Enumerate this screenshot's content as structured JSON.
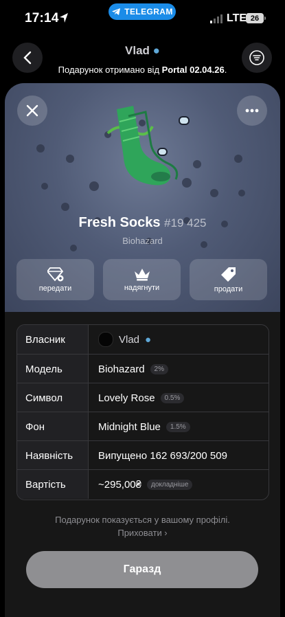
{
  "status_bar": {
    "time": "17:14",
    "telegram_label": "TELEGRAM",
    "network": "LTE",
    "battery": "26"
  },
  "header": {
    "name": "Vlad",
    "subtitle_prefix": "Подарунок отримано від ",
    "subtitle_bold": "Portal 02.04.26",
    "subtitle_suffix": "."
  },
  "gift": {
    "name": "Fresh Socks",
    "number": "#19 425",
    "model": "Biohazard"
  },
  "actions": [
    {
      "label": "передати",
      "icon": "gem-transfer-icon"
    },
    {
      "label": "надягнути",
      "icon": "crown-icon"
    },
    {
      "label": "продати",
      "icon": "price-tag-icon"
    }
  ],
  "details": [
    {
      "label": "Власник",
      "value": "Vlad",
      "badge": ""
    },
    {
      "label": "Модель",
      "value": "Biohazard",
      "badge": "2%"
    },
    {
      "label": "Символ",
      "value": "Lovely Rose",
      "badge": "0.5%"
    },
    {
      "label": "Фон",
      "value": "Midnight Blue",
      "badge": "1.5%"
    },
    {
      "label": "Наявність",
      "value": "Випущено 162 693/200 509",
      "badge": ""
    },
    {
      "label": "Вартість",
      "value": "~295,00₴",
      "badge": "докладніше"
    }
  ],
  "note": {
    "text": "Подарунок показується у вашому профілі.",
    "link": "Приховати ›"
  },
  "ok_button": "Гаразд",
  "colors": {
    "telegram_blue": "#1b8ce8",
    "hero_bg": "#505b76",
    "sock_green": "#2fa55a",
    "button_gray": "#8f8f92"
  }
}
